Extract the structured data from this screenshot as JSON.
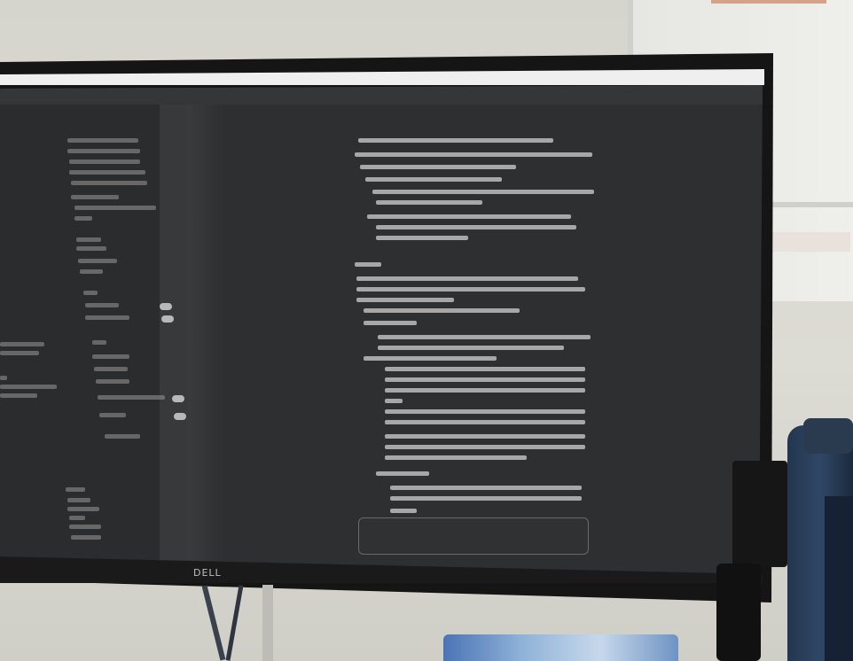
{
  "scene": {
    "type": "photo-of-monitor",
    "monitor_brand": "DELL",
    "ui_theme": "dark",
    "colors": {
      "wall": "#d9d8d2",
      "screen_bg": "#2e2f31",
      "text": "#c9c9c9"
    },
    "objects": [
      "monitor",
      "whiteboard",
      "microphone",
      "water-bottle",
      "desk-item"
    ]
  }
}
